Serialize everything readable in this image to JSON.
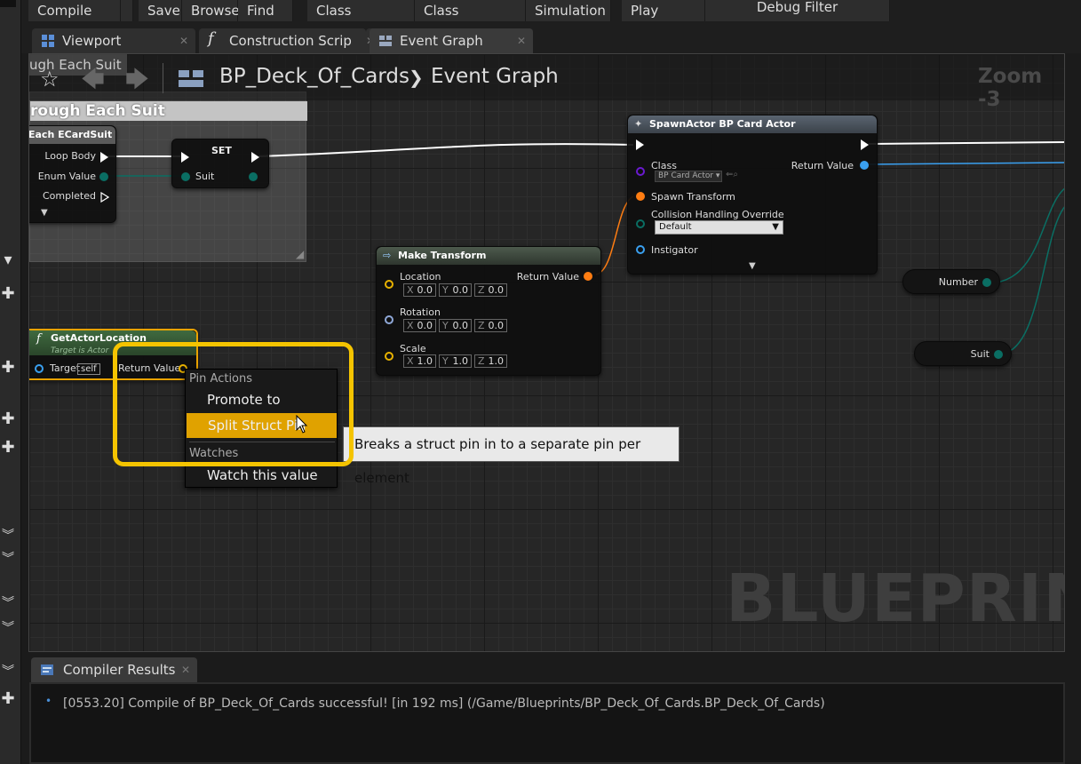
{
  "toolbar": {
    "compile": "Compile",
    "save": "Save",
    "browse": "Browse",
    "find": "Find",
    "class_settings": "Class Settings",
    "class_defaults": "Class Defaults",
    "simulation": "Simulation",
    "play": "Play",
    "debug_filter": "Debug Filter"
  },
  "tabs": [
    {
      "label": "Viewport",
      "icon": "viewport-icon"
    },
    {
      "label": "Construction Scrip",
      "icon": "function-icon"
    },
    {
      "label": "Event Graph",
      "icon": "event-graph-icon"
    }
  ],
  "breadcrumb": {
    "blueprint": "BP_Deck_Of_Cards",
    "separator": "❯",
    "graph": "Event Graph",
    "zoom": "Zoom -3",
    "overlay_comment": "ugh Each Suit"
  },
  "comment_box": {
    "title": "rough Each Suit"
  },
  "nodes": {
    "foreach": {
      "title": "Each ECardSuit",
      "pins": [
        "Loop Body",
        "Enum Value",
        "Completed"
      ]
    },
    "set": {
      "title": "SET",
      "pin": "Suit"
    },
    "spawn_actor": {
      "title": "SpawnActor BP Card Actor",
      "class_label": "Class",
      "class_value": "BP Card Actor",
      "return_value": "Return Value",
      "spawn_transform": "Spawn Transform",
      "collision_label": "Collision Handling Override",
      "collision_value": "Default",
      "instigator": "Instigator"
    },
    "make_transform": {
      "title": "Make Transform",
      "return_value": "Return Value",
      "rows": [
        {
          "label": "Location",
          "x": "0.0",
          "y": "0.0",
          "z": "0.0"
        },
        {
          "label": "Rotation",
          "x": "0.0",
          "y": "0.0",
          "z": "0.0"
        },
        {
          "label": "Scale",
          "x": "1.0",
          "y": "1.0",
          "z": "1.0"
        }
      ],
      "axis_labels": [
        "X",
        "Y",
        "Z"
      ]
    },
    "number_var": {
      "label": "Number"
    },
    "suit_var": {
      "label": "Suit"
    },
    "get_actor_location": {
      "title": "GetActorLocation",
      "subtitle": "Target is Actor",
      "target": "Target",
      "self": "self",
      "return_value": "Return Value"
    }
  },
  "context_menu": {
    "section_pin_actions": "Pin Actions",
    "promote": "Promote to Variable",
    "split": "Split Struct Pin",
    "section_watches": "Watches",
    "watch": "Watch this value"
  },
  "tooltip": "Breaks a struct pin in to a separate pin per element",
  "watermark": "BLUEPRINT",
  "compiler": {
    "tab": "Compiler Results",
    "message": "[0553.20] Compile of BP_Deck_Of_Cards successful! [in 192 ms] (/Game/Blueprints/BP_Deck_Of_Cards.BP_Deck_Of_Cards)"
  },
  "colors": {
    "highlight": "#f5c400",
    "menu_selected": "#e0a200",
    "exec_wire": "#ffffff",
    "struct_pin": "#e8b200",
    "enum_pin": "#0a6e63",
    "object_pin": "#3aa0f0",
    "class_pin": "#6a1ad0",
    "transform_pin": "#ff7d12"
  }
}
